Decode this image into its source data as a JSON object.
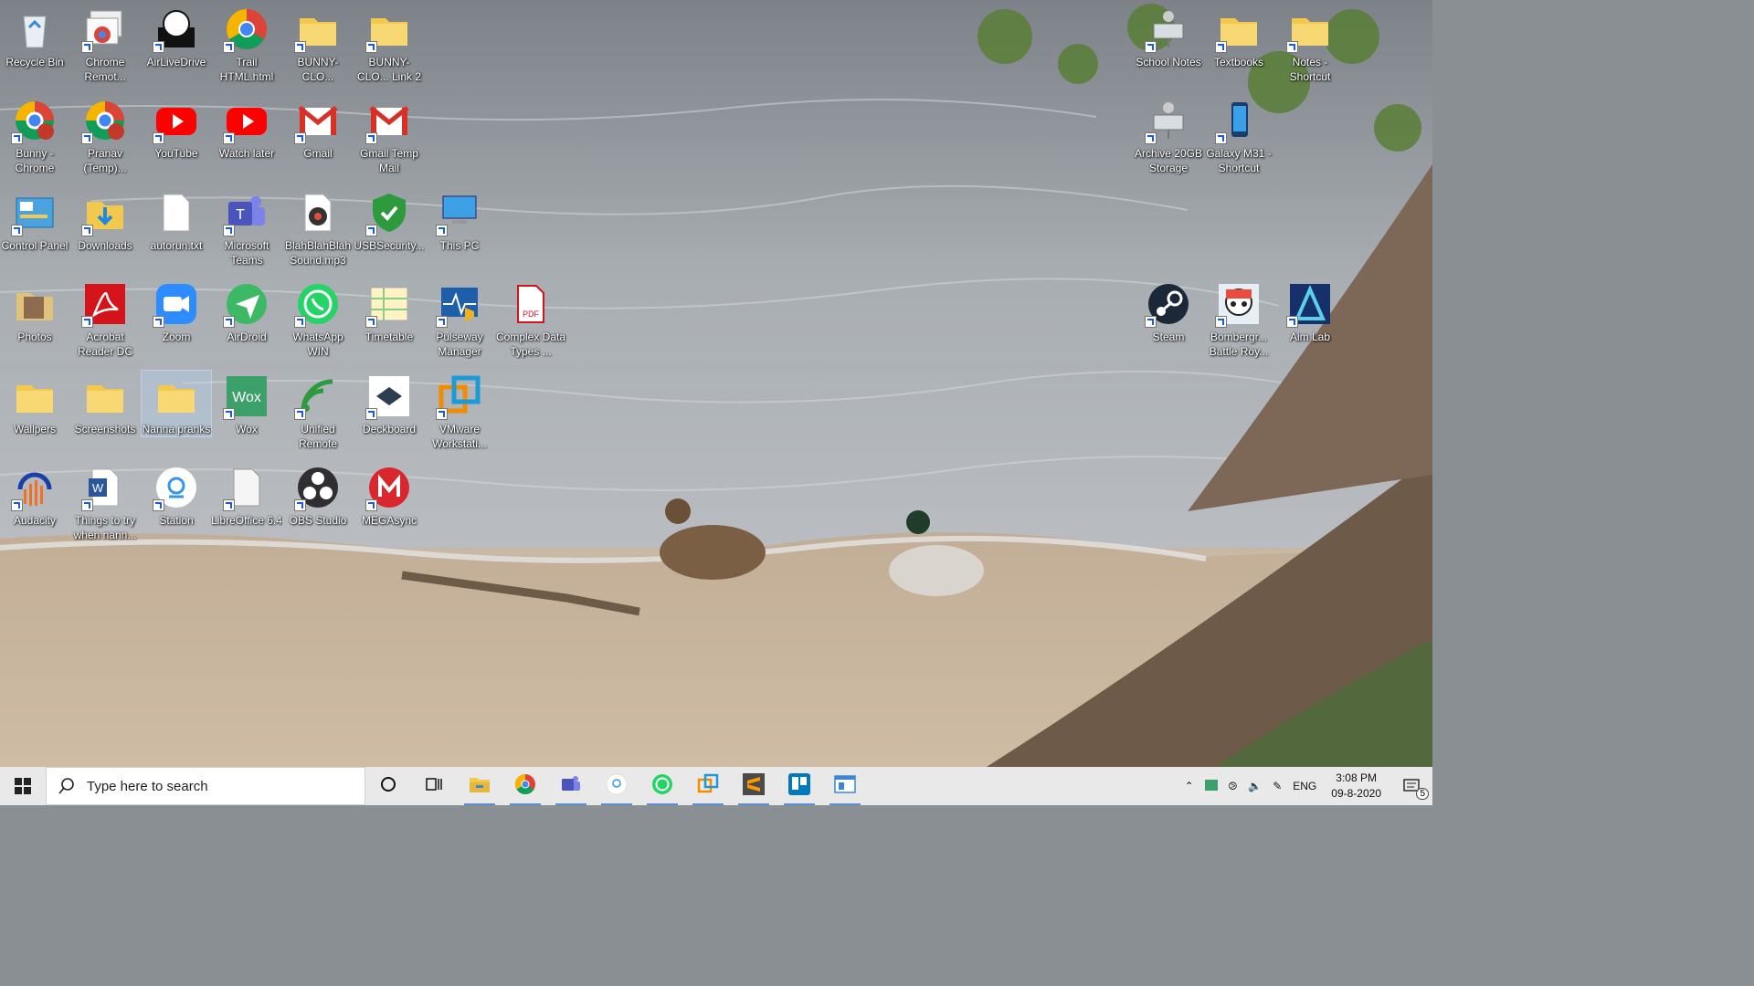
{
  "desktop": {
    "icons_left": [
      {
        "label": "Recycle Bin",
        "icon": "recycle-bin-icon",
        "shortcut": false
      },
      {
        "label": "Chrome Remot...",
        "icon": "chrome-remote-icon",
        "shortcut": true
      },
      {
        "label": "AirLiveDrive",
        "icon": "airlivedrive-icon",
        "shortcut": true
      },
      {
        "label": "Trail HTML.html",
        "icon": "chrome-icon",
        "shortcut": true
      },
      {
        "label": "BUNNY-CLO...",
        "icon": "folder-icon",
        "shortcut": true
      },
      {
        "label": "BUNNY-CLO... Link 2",
        "icon": "folder-icon",
        "shortcut": true
      },
      {
        "label": "Bunny - Chrome",
        "icon": "chrome-profile-icon",
        "shortcut": true
      },
      {
        "label": "Pranav (Temp)...",
        "icon": "chrome-profile-icon",
        "shortcut": true
      },
      {
        "label": "YouTube",
        "icon": "youtube-icon",
        "shortcut": true
      },
      {
        "label": "Watch later",
        "icon": "youtube-icon",
        "shortcut": true
      },
      {
        "label": "Gmail",
        "icon": "gmail-icon",
        "shortcut": true
      },
      {
        "label": "Gmail Temp Mail",
        "icon": "gmail-icon",
        "shortcut": true
      },
      {
        "label": "Control Panel",
        "icon": "control-panel-icon",
        "shortcut": true
      },
      {
        "label": "Downloads",
        "icon": "downloads-folder-icon",
        "shortcut": true
      },
      {
        "label": "autorun.txt",
        "icon": "text-file-icon",
        "shortcut": false
      },
      {
        "label": "Microsoft Teams",
        "icon": "teams-icon",
        "shortcut": true
      },
      {
        "label": "BlahBlahBlah Sound.mp3",
        "icon": "audio-file-icon",
        "shortcut": false
      },
      {
        "label": "USBSecurity...",
        "icon": "shield-icon",
        "shortcut": true
      },
      {
        "label": "This PC",
        "icon": "this-pc-icon",
        "shortcut": true
      },
      {
        "label": "Photos",
        "icon": "photos-folder-icon",
        "shortcut": false
      },
      {
        "label": "Acrobat Reader DC",
        "icon": "acrobat-icon",
        "shortcut": true
      },
      {
        "label": "Zoom",
        "icon": "zoom-icon",
        "shortcut": true
      },
      {
        "label": "AirDroid",
        "icon": "airdroid-icon",
        "shortcut": true
      },
      {
        "label": "WhatsApp WIN",
        "icon": "whatsapp-icon",
        "shortcut": true
      },
      {
        "label": "Timetable",
        "icon": "spreadsheet-icon",
        "shortcut": true
      },
      {
        "label": "Pulseway Manager",
        "icon": "pulseway-icon",
        "shortcut": true
      },
      {
        "label": "Complex Data Types ...",
        "icon": "pdf-icon",
        "shortcut": false
      },
      {
        "label": "Wallpers",
        "icon": "folder-icon",
        "shortcut": false
      },
      {
        "label": "Screenshots",
        "icon": "folder-icon",
        "shortcut": false
      },
      {
        "label": "Nanna pranks",
        "icon": "folder-icon",
        "shortcut": false
      },
      {
        "label": "Wox",
        "icon": "wox-icon",
        "shortcut": true
      },
      {
        "label": "Unified Remote",
        "icon": "unified-remote-icon",
        "shortcut": true
      },
      {
        "label": "Deckboard",
        "icon": "deckboard-icon",
        "shortcut": true
      },
      {
        "label": "VMware Workstati...",
        "icon": "vmware-icon",
        "shortcut": true
      },
      {
        "label": "Audacity",
        "icon": "audacity-icon",
        "shortcut": true
      },
      {
        "label": "Things to try when nann...",
        "icon": "word-icon",
        "shortcut": true
      },
      {
        "label": "Station",
        "icon": "station-icon",
        "shortcut": true
      },
      {
        "label": "LibreOffice 6.4",
        "icon": "libreoffice-icon",
        "shortcut": true
      },
      {
        "label": "OBS Studio",
        "icon": "obs-icon",
        "shortcut": true
      },
      {
        "label": "MEGAsync",
        "icon": "mega-icon",
        "shortcut": true
      }
    ],
    "icons_right": [
      {
        "label": "School Notes",
        "icon": "network-drive-icon",
        "shortcut": true
      },
      {
        "label": "Textbooks",
        "icon": "folder-icon",
        "shortcut": true
      },
      {
        "label": "Notes - Shortcut",
        "icon": "folder-icon",
        "shortcut": true
      },
      {
        "label": "Archive 20GB Storage",
        "icon": "network-drive-icon",
        "shortcut": true
      },
      {
        "label": "Galaxy M31 - Shortcut",
        "icon": "phone-icon",
        "shortcut": true
      },
      {
        "label": "Steam",
        "icon": "steam-icon",
        "shortcut": true
      },
      {
        "label": "Bombergr... Battle Roy...",
        "icon": "game-icon",
        "shortcut": true
      },
      {
        "label": "Aim Lab",
        "icon": "aimlab-icon",
        "shortcut": true
      }
    ]
  },
  "taskbar": {
    "search_placeholder": "Type here to search",
    "apps": [
      {
        "name": "cortana-icon"
      },
      {
        "name": "task-view-icon"
      },
      {
        "name": "file-explorer-icon"
      },
      {
        "name": "chrome-icon"
      },
      {
        "name": "teams-icon"
      },
      {
        "name": "station-icon"
      },
      {
        "name": "whatsapp-icon"
      },
      {
        "name": "vmware-icon"
      },
      {
        "name": "sublime-text-icon"
      },
      {
        "name": "trello-icon"
      },
      {
        "name": "window-app-icon"
      }
    ],
    "tray": {
      "language": "ENG",
      "time": "3:08 PM",
      "date": "09-8-2020",
      "notifications_count": "5"
    }
  },
  "colors": {
    "taskbar_bg": "#e9e9e9",
    "active_indicator": "#5b8cd6",
    "windows_blue": "#0078d7"
  }
}
